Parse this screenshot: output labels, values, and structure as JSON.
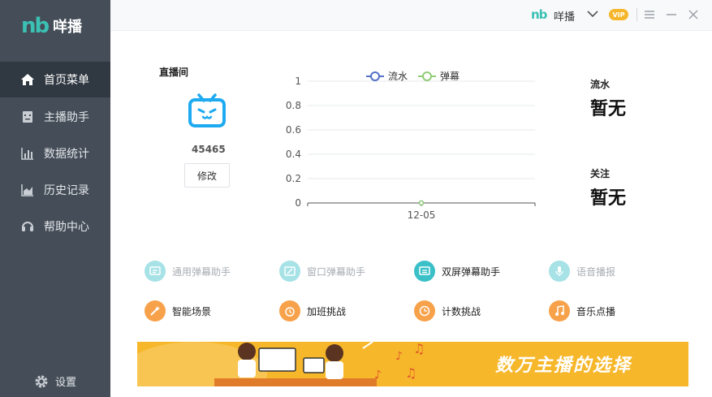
{
  "app": {
    "logo_mark": "nb",
    "name": "咩播"
  },
  "sidebar": {
    "items": [
      {
        "label": "首页菜单",
        "icon": "home-icon",
        "active": true
      },
      {
        "label": "主播助手",
        "icon": "robot-icon",
        "active": false
      },
      {
        "label": "数据统计",
        "icon": "bar-chart-icon",
        "active": false
      },
      {
        "label": "历史记录",
        "icon": "area-chart-icon",
        "active": false
      },
      {
        "label": "帮助中心",
        "icon": "headset-icon",
        "active": false
      }
    ],
    "settings_label": "设置"
  },
  "titlebar": {
    "logo_mark": "nb",
    "user_name": "咩播",
    "vip_badge": "VIP"
  },
  "room": {
    "title": "直播间",
    "id": "45465",
    "edit_label": "修改"
  },
  "stats": {
    "flow_label": "流水",
    "flow_value": "暂无",
    "follow_label": "关注",
    "follow_value": "暂无"
  },
  "chart_data": {
    "type": "line",
    "categories": [
      "12-05"
    ],
    "series": [
      {
        "name": "流水",
        "values": [
          0
        ],
        "color": "#5470c6"
      },
      {
        "name": "弹幕",
        "values": [
          0
        ],
        "color": "#91cc75"
      }
    ],
    "y_ticks": [
      "1",
      "0.8",
      "0.6",
      "0.4",
      "0.2",
      "0"
    ],
    "ylim": [
      0,
      1
    ],
    "grid": true,
    "legend": "top"
  },
  "tools": [
    {
      "label": "通用弹幕助手",
      "icon": "chat-icon",
      "enabled": false
    },
    {
      "label": "窗口弹幕助手",
      "icon": "edit-window-icon",
      "enabled": false
    },
    {
      "label": "双屏弹幕助手",
      "icon": "dual-screen-icon",
      "enabled": true
    },
    {
      "label": "语音播报",
      "icon": "microphone-icon",
      "enabled": false
    },
    {
      "label": "智能场景",
      "icon": "magic-wand-icon",
      "enabled": true
    },
    {
      "label": "加班挑战",
      "icon": "alarm-clock-icon",
      "enabled": true
    },
    {
      "label": "计数挑战",
      "icon": "counter-icon",
      "enabled": true
    },
    {
      "label": "音乐点播",
      "icon": "music-note-icon",
      "enabled": true
    }
  ],
  "banner": {
    "text": "数万主播的选择"
  },
  "colors": {
    "sidebar": "#454e58",
    "accent": "#3bc0b4",
    "banner": "#f6b72a"
  }
}
